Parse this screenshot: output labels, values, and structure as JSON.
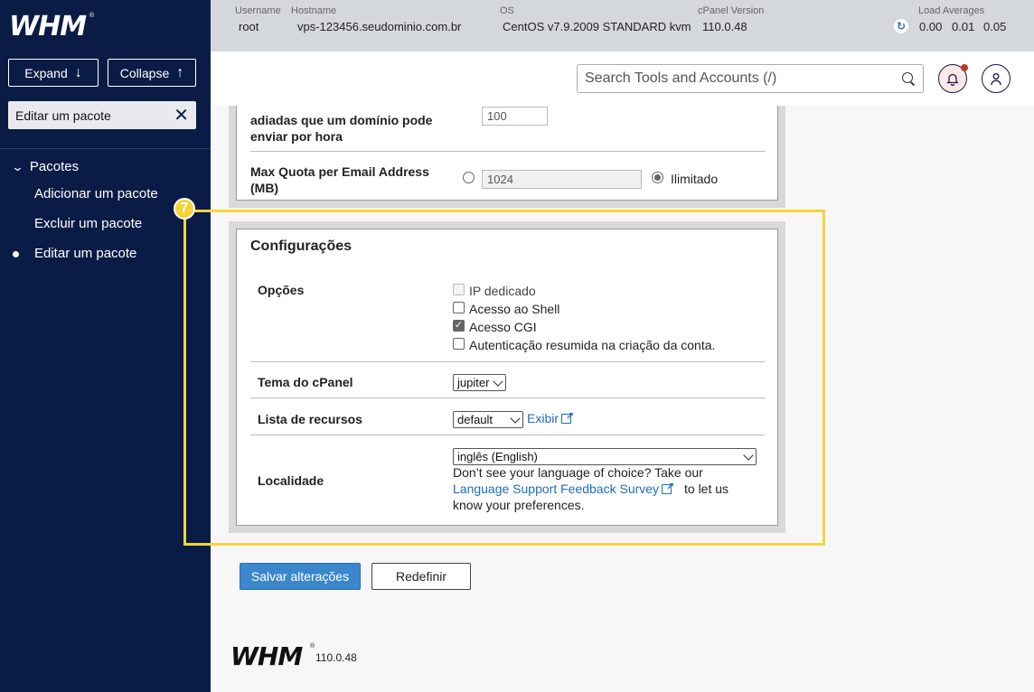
{
  "sidebar": {
    "logo": "WHM",
    "logo_mark": "®",
    "expand_label": "Expand",
    "collapse_label": "Collapse",
    "search_value": "Editar um pacote",
    "group_label": "Pacotes",
    "items": [
      {
        "label": "Adicionar um pacote"
      },
      {
        "label": "Excluir um pacote"
      },
      {
        "label": "Editar um pacote",
        "active": true
      }
    ]
  },
  "topbar": {
    "username_label": "Username",
    "username": "root",
    "hostname_label": "Hostname",
    "hostname": "vps-123456.seudominio.com.br",
    "os_label": "OS",
    "os": "CentOS v7.9.2009 STANDARD kvm",
    "cpanel_label": "cPanel Version",
    "cpanel_version": "110.0.48",
    "load_label": "Load Averages",
    "load": [
      "0.00",
      "0.01",
      "0.05"
    ]
  },
  "header": {
    "search_placeholder": "Search Tools and Accounts (/)"
  },
  "upper_panel": {
    "partial_value": "100",
    "deferred_label": "adiadas que um domínio pode enviar por hora",
    "quota_label": "Max Quota per Email Address (MB)",
    "quota_value": "1024",
    "unlimited_label": "Ilimitado"
  },
  "config": {
    "badge": "7",
    "title": "Configurações",
    "options_label": "Opções",
    "options": [
      {
        "label": "IP dedicado",
        "checked": false,
        "disabled": true
      },
      {
        "label": "Acesso ao Shell",
        "checked": false,
        "disabled": false
      },
      {
        "label": "Acesso CGI",
        "checked": true,
        "disabled": false
      },
      {
        "label": "Autenticação resumida na criação da conta.",
        "checked": false,
        "disabled": false
      }
    ],
    "theme_label": "Tema do cPanel",
    "theme_value": "jupiter",
    "resources_label": "Lista de recursos",
    "resources_value": "default",
    "view_link": "Exibir",
    "locale_label": "Localidade",
    "locale_value": "inglês (English)",
    "locale_note_1": "Don’t see your language of choice? Take our",
    "locale_link": "Language Support Feedback Survey",
    "locale_note_2": "to let us",
    "locale_note_3": "know your preferences."
  },
  "actions": {
    "save": "Salvar alterações",
    "reset": "Redefinir"
  },
  "footer": {
    "logo": "WHM",
    "logo_mark": "®",
    "version": "110.0.48"
  }
}
